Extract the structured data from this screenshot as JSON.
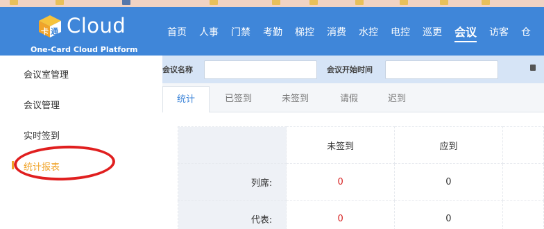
{
  "header": {
    "logo_text": "Cloud",
    "logo_subtitle": "One-Card Cloud Platform",
    "nav": [
      "首页",
      "人事",
      "门禁",
      "考勤",
      "梯控",
      "消费",
      "水控",
      "电控",
      "巡更",
      "会议",
      "访客",
      "仓"
    ],
    "active_nav": "会议"
  },
  "sidebar": {
    "items": [
      "会议室管理",
      "会议管理",
      "实时签到",
      "统计报表"
    ],
    "active": "统计报表"
  },
  "filter": {
    "name_label": "会议名称",
    "name_value": "",
    "start_label": "会议开始时间",
    "start_value": ""
  },
  "tabs": [
    "统计",
    "已签到",
    "未签到",
    "请假",
    "迟到"
  ],
  "active_tab": "统计",
  "stats_table": {
    "columns": [
      "未签到",
      "应到"
    ],
    "rows": [
      {
        "label": "列席:",
        "values": [
          "0",
          "0"
        ]
      },
      {
        "label": "代表:",
        "values": [
          "0",
          "0"
        ]
      }
    ]
  },
  "colors": {
    "brand_blue": "#3f86d9",
    "accent_orange": "#f0a42a",
    "annotation_red": "#e01f1f",
    "value_red": "#d62020"
  }
}
